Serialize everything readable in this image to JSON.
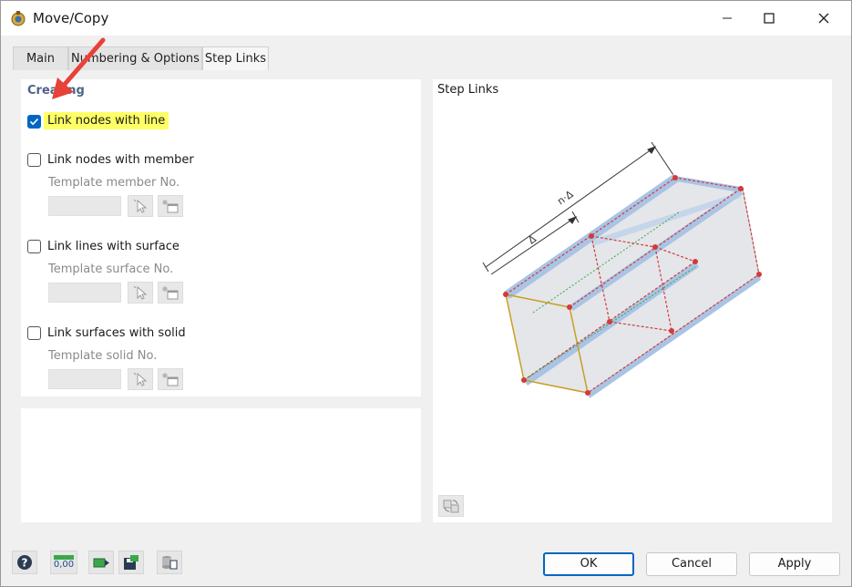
{
  "window": {
    "title": "Move/Copy"
  },
  "tabs": [
    {
      "label": "Main"
    },
    {
      "label": "Numbering & Options"
    },
    {
      "label": "Step Links"
    }
  ],
  "creating": {
    "group_title": "Creating",
    "link_nodes_line": {
      "label": "Link nodes with line",
      "checked": true
    },
    "link_nodes_member": {
      "label": "Link nodes with member",
      "checked": false,
      "template_label": "Template member No.",
      "value": ""
    },
    "link_lines_surface": {
      "label": "Link lines with surface",
      "checked": false,
      "template_label": "Template surface No.",
      "value": ""
    },
    "link_surfaces_solid": {
      "label": "Link surfaces with solid",
      "checked": false,
      "template_label": "Template solid No.",
      "value": ""
    }
  },
  "preview": {
    "title": "Step Links",
    "dim_outer": "n·Δ",
    "dim_inner": "Δ"
  },
  "buttons": {
    "ok": "OK",
    "cancel": "Cancel",
    "apply": "Apply"
  },
  "toolbar": {
    "units_label": "0,00"
  },
  "colors": {
    "accent": "#0067c0",
    "highlight": "#ffff66",
    "annotation_arrow": "#e8413a"
  }
}
